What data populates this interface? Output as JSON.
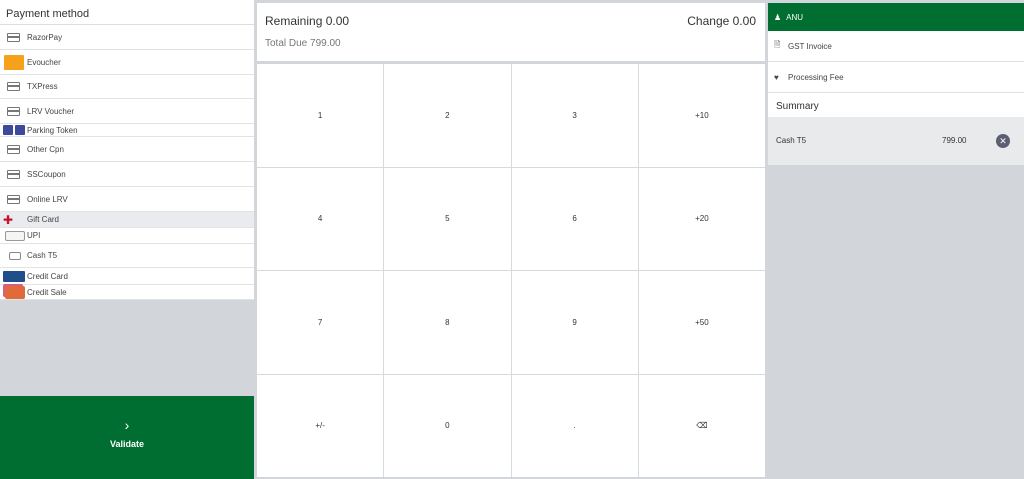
{
  "payment": {
    "header": "Payment method",
    "methods": [
      {
        "label": "RazorPay",
        "icon": "card-icon"
      },
      {
        "label": "Evoucher",
        "icon": "voucher-icon"
      },
      {
        "label": "TXPress",
        "icon": "card-icon"
      },
      {
        "label": "LRV Voucher",
        "icon": "card-icon"
      },
      {
        "label": "Parking Token",
        "icon": "token-icon"
      },
      {
        "label": "Other Cpn",
        "icon": "card-icon"
      },
      {
        "label": "SSCoupon",
        "icon": "card-icon"
      },
      {
        "label": "Online LRV",
        "icon": "card-icon"
      },
      {
        "label": "Gift Card",
        "icon": "gift-card-icon"
      },
      {
        "label": "UPI",
        "icon": "upi-icon"
      },
      {
        "label": "Cash T5",
        "icon": "cash-icon"
      },
      {
        "label": "Credit Card",
        "icon": "credit-card-icon"
      },
      {
        "label": "Credit Sale",
        "icon": "credit-sale-icon"
      }
    ],
    "validate_label": "Validate",
    "validate_icon": "chevron-right-icon"
  },
  "status": {
    "remaining": "Remaining 0.00",
    "change": "Change 0.00",
    "total_due": "Total Due  799.00"
  },
  "keypad": {
    "keys": [
      "1",
      "2",
      "3",
      "+10",
      "4",
      "5",
      "6",
      "+20",
      "7",
      "8",
      "9",
      "+50",
      "+/-",
      "0",
      ".",
      "⌫"
    ]
  },
  "customer": {
    "name": "ANU",
    "icon": "user-icon",
    "gst_label": "GST Invoice",
    "fee_label": "Processing Fee",
    "summary_title": "Summary"
  },
  "summary_lines": [
    {
      "name": "Cash T5",
      "amount": "799.00"
    }
  ],
  "colors": {
    "primary": "#006d31",
    "background": "#d2d6db"
  }
}
